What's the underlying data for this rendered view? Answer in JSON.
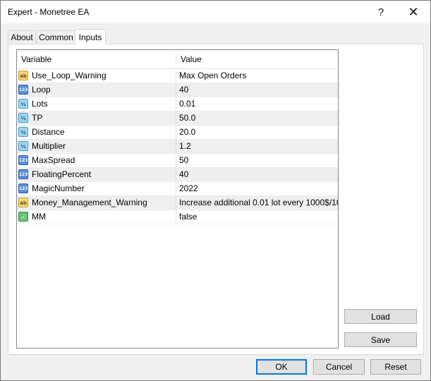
{
  "window": {
    "title": "Expert - Monetree EA",
    "help_glyph": "?",
    "close_glyph": "✕"
  },
  "tabs": [
    {
      "label": "About",
      "active": false
    },
    {
      "label": "Common",
      "active": false
    },
    {
      "label": "Inputs",
      "active": true
    }
  ],
  "grid": {
    "columns": [
      "Variable",
      "Value"
    ],
    "rows": [
      {
        "icon": "string-type-icon",
        "icon_text": "ab",
        "variable": "Use_Loop_Warning",
        "value": "Max Open Orders"
      },
      {
        "icon": "integer-type-icon",
        "icon_text": "123",
        "variable": "Loop",
        "value": "40"
      },
      {
        "icon": "double-type-icon",
        "icon_text": "½",
        "variable": "Lots",
        "value": "0.01"
      },
      {
        "icon": "double-type-icon",
        "icon_text": "½",
        "variable": "TP",
        "value": "50.0"
      },
      {
        "icon": "double-type-icon",
        "icon_text": "½",
        "variable": "Distance",
        "value": "20.0"
      },
      {
        "icon": "double-type-icon",
        "icon_text": "½",
        "variable": "Multiplier",
        "value": "1.2"
      },
      {
        "icon": "integer-type-icon",
        "icon_text": "123",
        "variable": "MaxSpread",
        "value": "50"
      },
      {
        "icon": "integer-type-icon",
        "icon_text": "123",
        "variable": "FloatingPercent",
        "value": "40"
      },
      {
        "icon": "integer-type-icon",
        "icon_text": "123",
        "variable": "MagicNumber",
        "value": "2022"
      },
      {
        "icon": "string-type-icon",
        "icon_text": "ab",
        "variable": "Money_Management_Warning",
        "value": "Increase additional 0.01 lot every 1000$/10..."
      },
      {
        "icon": "boolean-type-icon",
        "icon_text": "✓",
        "variable": "MM",
        "value": "false"
      }
    ]
  },
  "side_buttons": {
    "load": "Load",
    "save": "Save"
  },
  "footer_buttons": {
    "ok": "OK",
    "cancel": "Cancel",
    "reset": "Reset"
  }
}
